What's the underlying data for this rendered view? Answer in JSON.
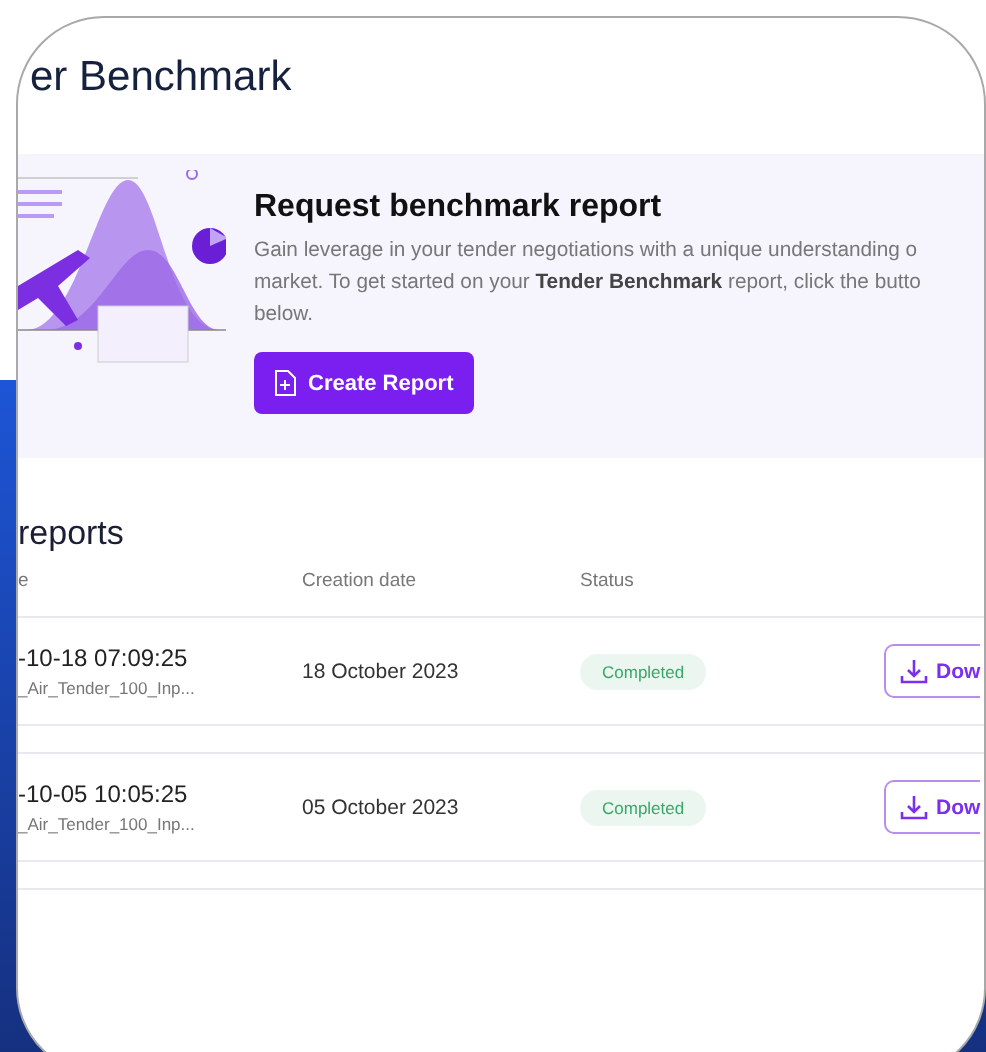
{
  "page_title": "er Benchmark",
  "banner": {
    "heading": "Request benchmark report",
    "description_lines": [
      "Gain leverage in your tender negotiations with a unique understanding o",
      "market. To get started on your **Tender Benchmark** report, click the butto",
      "below."
    ],
    "button": "Create Report"
  },
  "reports": {
    "title": "reports",
    "columns": [
      "e",
      "Creation date",
      "Status"
    ],
    "rows": [
      {
        "name": "-10-18 07:09:25",
        "file": "_Air_Tender_100_Inp...",
        "date": "18 October 2023",
        "status": "Completed",
        "action": "Dow"
      },
      {
        "name": "-10-05 10:05:25",
        "file": "_Air_Tender_100_Inp...",
        "date": "05 October 2023",
        "status": "Completed",
        "action": "Dow"
      }
    ]
  }
}
